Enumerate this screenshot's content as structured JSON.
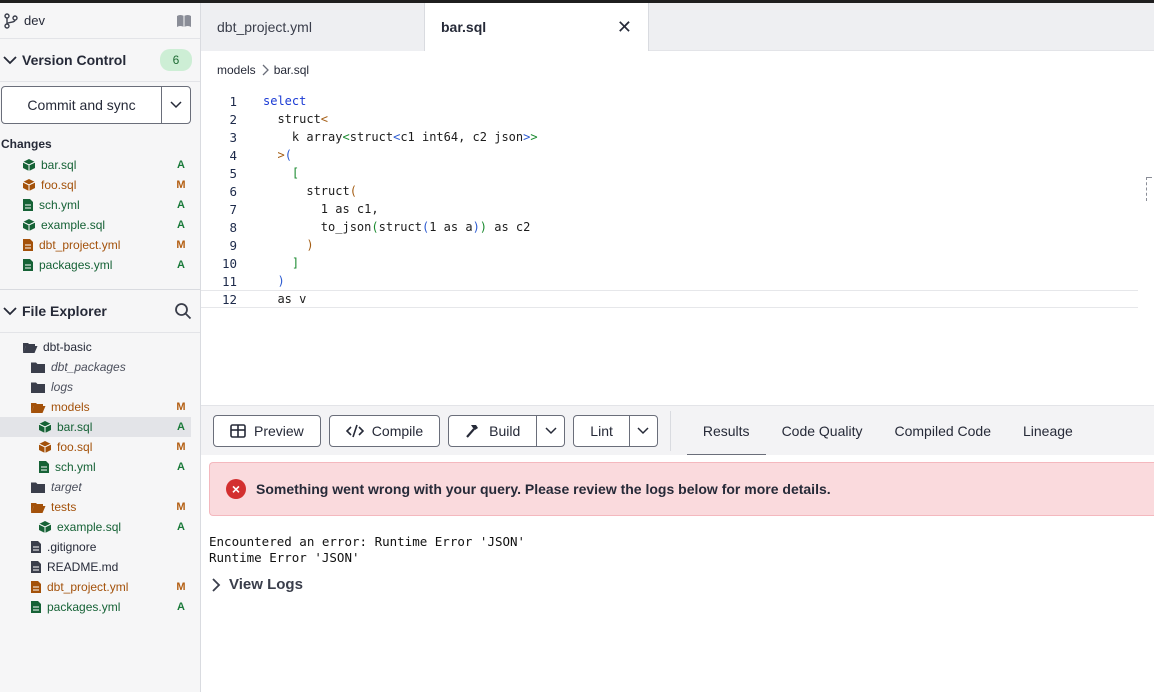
{
  "branch": {
    "name": "dev"
  },
  "version_control": {
    "title": "Version Control",
    "badge_count": "6",
    "commit_label": "Commit and sync",
    "changes_label": "Changes",
    "changes": [
      {
        "name": "bar.sql",
        "status": "A",
        "icon": "model-cube-icon"
      },
      {
        "name": "foo.sql",
        "status": "M",
        "icon": "model-cube-icon"
      },
      {
        "name": "sch.yml",
        "status": "A",
        "icon": "file-icon"
      },
      {
        "name": "example.sql",
        "status": "A",
        "icon": "model-cube-icon"
      },
      {
        "name": "dbt_project.yml",
        "status": "M",
        "icon": "file-icon"
      },
      {
        "name": "packages.yml",
        "status": "A",
        "icon": "file-icon"
      }
    ]
  },
  "file_explorer": {
    "title": "File Explorer",
    "tree": [
      {
        "name": "dbt-basic",
        "status": "",
        "icon": "folder-open-icon",
        "indent": 0
      },
      {
        "name": "dbt_packages",
        "status": "",
        "icon": "folder-icon",
        "indent": 1,
        "italic": true
      },
      {
        "name": "logs",
        "status": "",
        "icon": "folder-icon",
        "indent": 1,
        "italic": true
      },
      {
        "name": "models",
        "status": "M",
        "icon": "folder-open-icon",
        "indent": 1
      },
      {
        "name": "bar.sql",
        "status": "A",
        "icon": "model-cube-icon",
        "indent": 2,
        "selected": true
      },
      {
        "name": "foo.sql",
        "status": "M",
        "icon": "model-cube-icon",
        "indent": 2
      },
      {
        "name": "sch.yml",
        "status": "A",
        "icon": "file-icon",
        "indent": 2
      },
      {
        "name": "target",
        "status": "",
        "icon": "folder-icon",
        "indent": 1,
        "italic": true
      },
      {
        "name": "tests",
        "status": "M",
        "icon": "folder-open-icon",
        "indent": 1
      },
      {
        "name": "example.sql",
        "status": "A",
        "icon": "model-cube-icon",
        "indent": 2
      },
      {
        "name": ".gitignore",
        "status": "",
        "icon": "file-icon",
        "indent": 1
      },
      {
        "name": "README.md",
        "status": "",
        "icon": "file-icon",
        "indent": 1
      },
      {
        "name": "dbt_project.yml",
        "status": "M",
        "icon": "file-icon",
        "indent": 1
      },
      {
        "name": "packages.yml",
        "status": "A",
        "icon": "file-icon",
        "indent": 1
      }
    ]
  },
  "tabs": [
    {
      "label": "dbt_project.yml",
      "active": false
    },
    {
      "label": "bar.sql",
      "active": true,
      "close": "✕"
    }
  ],
  "breadcrumb": {
    "folder": "models",
    "file": "bar.sql"
  },
  "editor": {
    "lines": [
      {
        "n": "1",
        "html": "<span class='kw'>select</span>"
      },
      {
        "n": "2",
        "html": "  struct<span class='br1'>&lt;</span>"
      },
      {
        "n": "3",
        "html": "    k array<span class='br2'>&lt;</span>struct<span class='br3'>&lt;</span>c1 int64, c2 json<span class='br3'>&gt;</span><span class='br2'>&gt;</span>"
      },
      {
        "n": "4",
        "html": "  <span class='br1'>&gt;</span><span class='br3'>(</span>"
      },
      {
        "n": "5",
        "html": "    <span class='br2'>[</span>"
      },
      {
        "n": "6",
        "html": "      struct<span class='br1'>(</span>"
      },
      {
        "n": "7",
        "html": "        1 as c1,"
      },
      {
        "n": "8",
        "html": "        to_json<span class='br2'>(</span>struct<span class='br3'>(</span>1 as a<span class='br3'>)</span><span class='br2'>)</span> as c2"
      },
      {
        "n": "9",
        "html": "      <span class='br1'>)</span>"
      },
      {
        "n": "10",
        "html": "    <span class='br2'>]</span>"
      },
      {
        "n": "11",
        "html": "  <span class='br3'>)</span>"
      },
      {
        "n": "12",
        "html": "  as v"
      }
    ],
    "current_line": "12"
  },
  "toolbar": {
    "preview": "Preview",
    "compile": "Compile",
    "build": "Build",
    "lint": "Lint"
  },
  "result_tabs": [
    {
      "label": "Results",
      "active": true
    },
    {
      "label": "Code Quality",
      "active": false
    },
    {
      "label": "Compiled Code",
      "active": false
    },
    {
      "label": "Lineage",
      "active": false
    }
  ],
  "results": {
    "error_icon": "×",
    "error_message": "Something went wrong with your query. Please review the logs below for more details.",
    "log_line_1": "Encountered an error: Runtime Error 'JSON'",
    "log_line_2": "Runtime Error 'JSON'",
    "view_logs": "View Logs"
  },
  "colors": {
    "added": "#1a7a3a",
    "modified": "#b35f13",
    "error_bg": "#fadadd",
    "error_icon": "#d32f2f",
    "badge_bg": "#cdeed5"
  }
}
